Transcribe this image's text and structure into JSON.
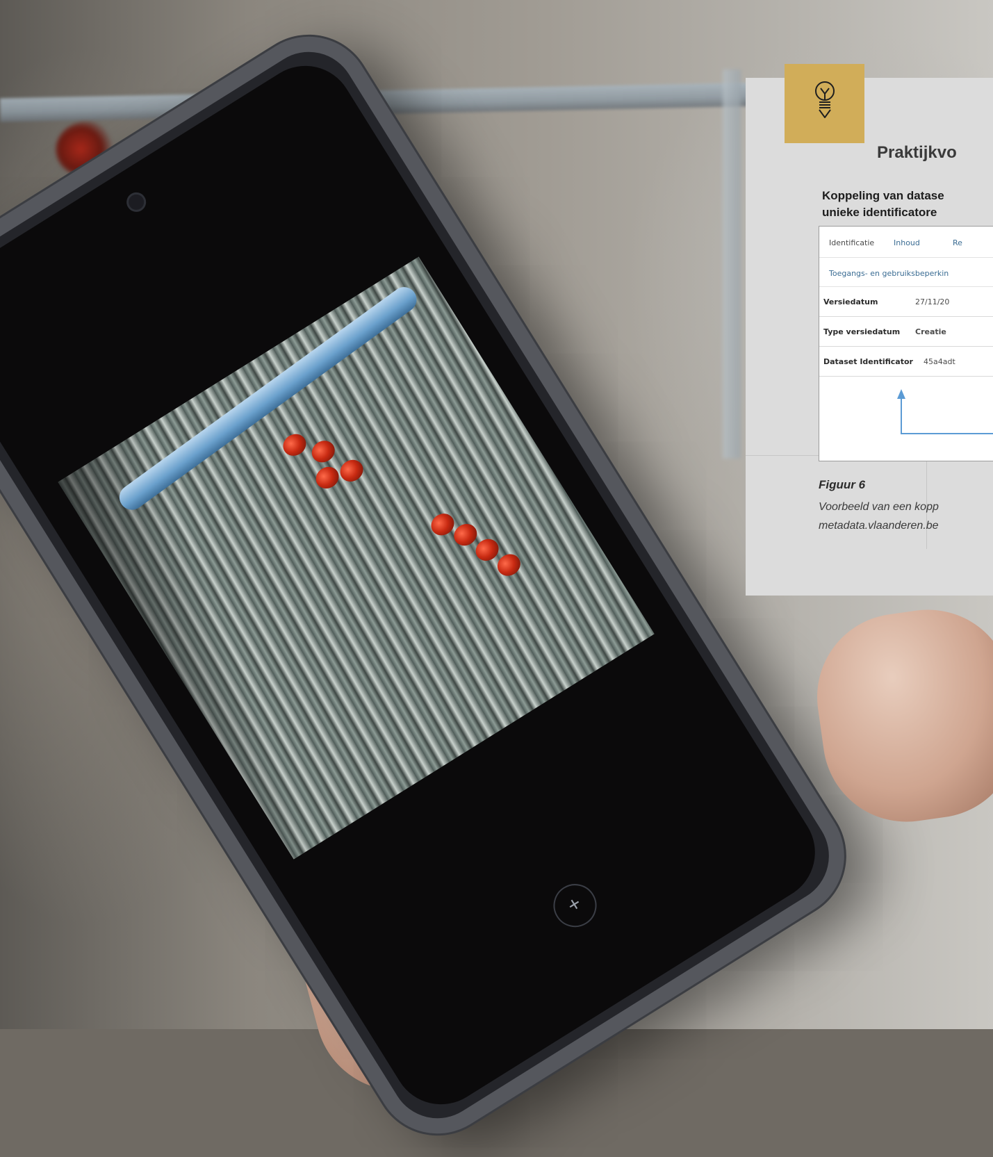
{
  "callout": {
    "title": "Praktijkvo",
    "subtitle_line1": "Koppeling van datase",
    "subtitle_line2": "unieke identificatore",
    "icon": "lightbulb-icon",
    "accent_color": "#d1ad59",
    "card_color": "#dcdcdc"
  },
  "screenshot": {
    "tabs": [
      "Identificatie",
      "Inhoud",
      "Re"
    ],
    "sub_link": "Toegangs- en gebruiksbeperkin",
    "rows": [
      {
        "key": "Versiedatum",
        "value": "27/11/20"
      },
      {
        "key": "Type versiedatum",
        "value": "Creatie"
      },
      {
        "key": "Dataset Identificator",
        "value": "45a4adt"
      }
    ],
    "link_color": "#3a6c93",
    "arrow_color": "#5b9bd5"
  },
  "figure": {
    "label": "Figuur 6",
    "caption_line1": "Voorbeeld van een kopp",
    "caption_line2": "metadata.vlaanderen.be"
  },
  "phone": {
    "shutter_symbol": "+"
  }
}
